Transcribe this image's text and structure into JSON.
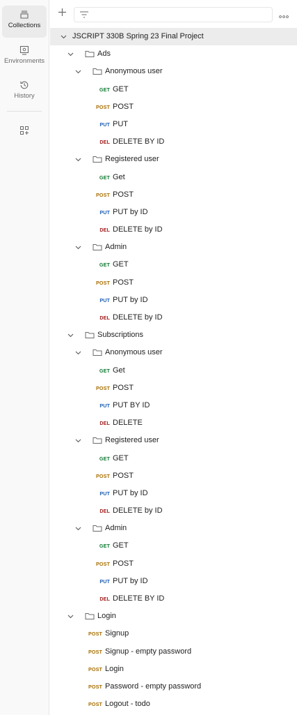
{
  "sidebar": {
    "collections": {
      "label": "Collections"
    },
    "environments": {
      "label": "Environments"
    },
    "history": {
      "label": "History"
    }
  },
  "colors": {
    "get": "#0f7a32",
    "post": "#a86e00",
    "put": "#1e5fb5",
    "delete": "#a3211f"
  },
  "collection": {
    "name": "JSCRIPT 330B Spring 23 Final Project",
    "folders": [
      {
        "name": "Ads",
        "subfolders": [
          {
            "name": "Anonymous user",
            "requests": [
              {
                "method": "GET",
                "badge": "GET",
                "name": "GET"
              },
              {
                "method": "POST",
                "badge": "POST",
                "name": "POST"
              },
              {
                "method": "PUT",
                "badge": "PUT",
                "name": "PUT"
              },
              {
                "method": "DELETE",
                "badge": "DEL",
                "name": "DELETE BY ID"
              }
            ]
          },
          {
            "name": "Registered user",
            "requests": [
              {
                "method": "GET",
                "badge": "GET",
                "name": "Get"
              },
              {
                "method": "POST",
                "badge": "POST",
                "name": "POST"
              },
              {
                "method": "PUT",
                "badge": "PUT",
                "name": "PUT by ID"
              },
              {
                "method": "DELETE",
                "badge": "DEL",
                "name": "DELETE by ID"
              }
            ]
          },
          {
            "name": "Admin",
            "requests": [
              {
                "method": "GET",
                "badge": "GET",
                "name": "GET"
              },
              {
                "method": "POST",
                "badge": "POST",
                "name": "POST"
              },
              {
                "method": "PUT",
                "badge": "PUT",
                "name": "PUT by ID"
              },
              {
                "method": "DELETE",
                "badge": "DEL",
                "name": "DELETE by ID"
              }
            ]
          }
        ]
      },
      {
        "name": "Subscriptions",
        "subfolders": [
          {
            "name": "Anonymous user",
            "requests": [
              {
                "method": "GET",
                "badge": "GET",
                "name": "Get"
              },
              {
                "method": "POST",
                "badge": "POST",
                "name": "POST"
              },
              {
                "method": "PUT",
                "badge": "PUT",
                "name": "PUT BY ID"
              },
              {
                "method": "DELETE",
                "badge": "DEL",
                "name": "DELETE"
              }
            ]
          },
          {
            "name": "Registered user",
            "requests": [
              {
                "method": "GET",
                "badge": "GET",
                "name": "GET"
              },
              {
                "method": "POST",
                "badge": "POST",
                "name": "POST"
              },
              {
                "method": "PUT",
                "badge": "PUT",
                "name": "PUT by ID"
              },
              {
                "method": "DELETE",
                "badge": "DEL",
                "name": "DELETE by ID"
              }
            ]
          },
          {
            "name": "Admin",
            "requests": [
              {
                "method": "GET",
                "badge": "GET",
                "name": "GET"
              },
              {
                "method": "POST",
                "badge": "POST",
                "name": "POST"
              },
              {
                "method": "PUT",
                "badge": "PUT",
                "name": "PUT by ID"
              },
              {
                "method": "DELETE",
                "badge": "DEL",
                "name": "DELETE BY ID"
              }
            ]
          }
        ]
      },
      {
        "name": "Login",
        "requests": [
          {
            "method": "POST",
            "badge": "POST",
            "name": "Signup"
          },
          {
            "method": "POST",
            "badge": "POST",
            "name": "Signup - empty password"
          },
          {
            "method": "POST",
            "badge": "POST",
            "name": "Login"
          },
          {
            "method": "POST",
            "badge": "POST",
            "name": "Password - empty password"
          },
          {
            "method": "POST",
            "badge": "POST",
            "name": "Logout - todo"
          }
        ]
      }
    ]
  }
}
